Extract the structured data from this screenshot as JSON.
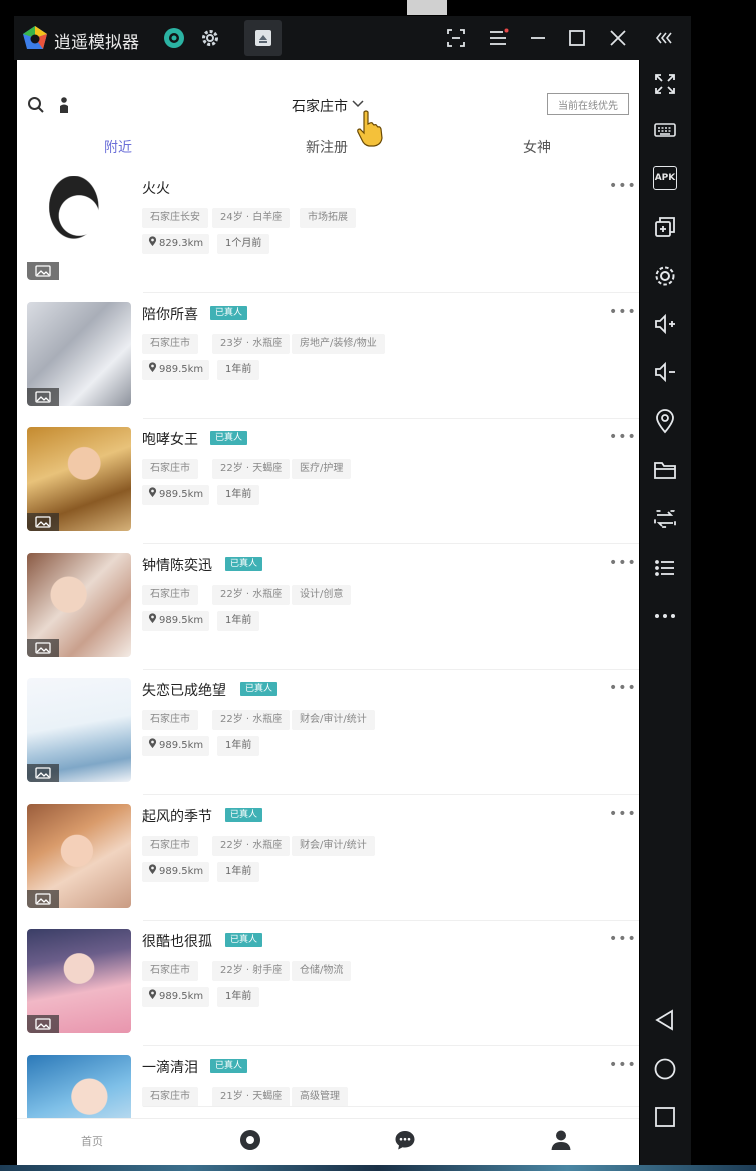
{
  "emulator": {
    "name": "逍遥模拟器",
    "title_icons": [
      "record-icon",
      "gear-icon",
      "app-tab-icon",
      "screenshot-icon",
      "menu-icon",
      "minimize-icon",
      "maximize-icon",
      "close-icon",
      "collapse-icon"
    ],
    "sidebar": {
      "apk_label": "APK",
      "icons": [
        "fullscreen-icon",
        "keyboard-icon",
        "apk-icon",
        "multi-window-icon",
        "settings-icon",
        "volume-up-icon",
        "volume-down-icon",
        "location-icon",
        "folder-icon",
        "rotate-icon",
        "list-icon",
        "more-icon",
        "back-icon",
        "home-icon",
        "recents-icon"
      ]
    }
  },
  "app": {
    "city": "石家庄市",
    "filter_button": "当前在线优先",
    "tabs": [
      {
        "label": "附近",
        "active": true
      },
      {
        "label": "新注册",
        "active": false
      },
      {
        "label": "女神",
        "active": false
      }
    ],
    "users": [
      {
        "name": "火火",
        "badge": "",
        "tags": [
          "石家庄长安",
          "24岁 · 白羊座",
          "市场拓展"
        ],
        "distance": "829.3km",
        "time": "1个月前"
      },
      {
        "name": "陪你所喜",
        "badge": "已真人",
        "tags": [
          "石家庄市",
          "23岁 · 水瓶座",
          "房地产/装修/物业"
        ],
        "distance": "989.5km",
        "time": "1年前"
      },
      {
        "name": "咆哮女王",
        "badge": "已真人",
        "tags": [
          "石家庄市",
          "22岁 · 天蝎座",
          "医疗/护理"
        ],
        "distance": "989.5km",
        "time": "1年前"
      },
      {
        "name": "钟情陈奕迅",
        "badge": "已真人",
        "tags": [
          "石家庄市",
          "22岁 · 水瓶座",
          "设计/创意"
        ],
        "distance": "989.5km",
        "time": "1年前"
      },
      {
        "name": "失恋已成绝望",
        "badge": "已真人",
        "tags": [
          "石家庄市",
          "22岁 · 水瓶座",
          "财会/审计/统计"
        ],
        "distance": "989.5km",
        "time": "1年前"
      },
      {
        "name": "起风的季节",
        "badge": "已真人",
        "tags": [
          "石家庄市",
          "22岁 · 水瓶座",
          "财会/审计/统计"
        ],
        "distance": "989.5km",
        "time": "1年前"
      },
      {
        "name": "很酷也很孤",
        "badge": "已真人",
        "tags": [
          "石家庄市",
          "22岁 · 射手座",
          "仓储/物流"
        ],
        "distance": "989.5km",
        "time": "1年前"
      },
      {
        "name": "一滴清泪",
        "badge": "已真人",
        "tags": [
          "石家庄市",
          "21岁 · 天蝎座",
          "高级管理"
        ],
        "distance": "",
        "time": ""
      }
    ],
    "more_label": "•••",
    "bottom_nav": [
      {
        "label": "首页",
        "icon": "home-label"
      },
      {
        "label": "",
        "icon": "discover-icon"
      },
      {
        "label": "",
        "icon": "chat-icon"
      },
      {
        "label": "",
        "icon": "profile-icon"
      }
    ]
  },
  "colors": {
    "accent_tab": "#6b6fd8",
    "badge": "#3fb1b5",
    "emulator_bg": "#121416"
  }
}
